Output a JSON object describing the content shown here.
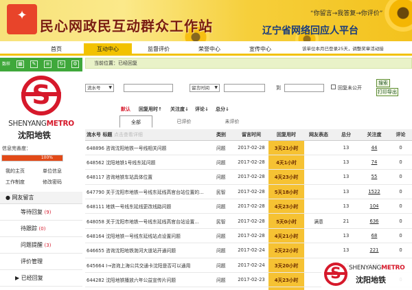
{
  "header": {
    "site_title": "民心网政民互动群众工作站",
    "slogan": "“你留言→我答复→你评价”",
    "platform": "辽宁省网络回应人平台"
  },
  "nav": {
    "tabs": [
      "首页",
      "互动中心",
      "监督评价",
      "荣誉中心",
      "宣传中心"
    ],
    "active": "互动中心",
    "notice": "该单位本月已登录25天，调整奖章活动接"
  },
  "sidebar": {
    "head_label": "数样",
    "head_icons": [
      "grid-icon",
      "edit-icon",
      "list-icon",
      "refresh-icon",
      "settings-icon"
    ],
    "org_en_prefix": "SHENYANG",
    "org_en_suffix": "METRO",
    "org_cn": "沈阳地铁",
    "info_label": "信息完善度：",
    "info_progress": "100%",
    "links": [
      "我的主页",
      "单位信息",
      "工作制度",
      "修改密码"
    ],
    "group_label": "网友留言",
    "menu": [
      {
        "label": "等待回复",
        "count": "(9)"
      },
      {
        "label": "待跟踪",
        "count": "(0)"
      },
      {
        "label": "问题提醒",
        "count": "(3)"
      },
      {
        "label": "评价管理",
        "count": ""
      },
      {
        "label": "已经回复",
        "count": ""
      }
    ]
  },
  "main": {
    "breadcrumb": "当前位置：已经回复",
    "filter": {
      "field_select": "流水号",
      "time_select": "留言时间",
      "to_label": "到",
      "unpublic_label": "回复未公开",
      "search_label": "搜索",
      "print_label": "打印导出"
    },
    "sort": {
      "default": "默认",
      "reply_time": "回复用时↑",
      "attention": "关注度↓",
      "comments": "评论↓",
      "score": "总分↓"
    },
    "subtabs": [
      "全部",
      "已评价",
      "未评价"
    ],
    "columns": [
      "流水号",
      "标题",
      "点击查看详细",
      "类别",
      "留言时间",
      "回复用时",
      "网友表态",
      "总分",
      "关注度",
      "评论"
    ],
    "rows": [
      {
        "id": "648896",
        "title": "咨询沈阳地铁一号线相关问题",
        "cat": "问题",
        "date": "2017-02-28",
        "time": "3天21小时",
        "stance": "",
        "score": "13",
        "attn": "44",
        "cmt": "0"
      },
      {
        "id": "648562",
        "title": "沈阳地铁1号线东延问题",
        "cat": "问题",
        "date": "2017-02-28",
        "time": "4天1小时",
        "stance": "",
        "score": "13",
        "attn": "74",
        "cmt": "0"
      },
      {
        "id": "648117",
        "title": "咨询地铁车站具体位置",
        "cat": "问题",
        "date": "2017-02-28",
        "time": "4天23小时",
        "stance": "",
        "score": "13",
        "attn": "55",
        "cmt": "0"
      },
      {
        "id": "647790",
        "title": "关于沈阳市地铁一号线东延线高官台站位置的...",
        "cat": "民智",
        "date": "2017-02-28",
        "time": "5天18小时",
        "stance": "",
        "score": "13",
        "attn": "1522",
        "cmt": "0"
      },
      {
        "id": "648111",
        "title": "地铁一号线东延线更改线路问题",
        "cat": "问题",
        "date": "2017-02-28",
        "time": "4天23小时",
        "stance": "",
        "score": "13",
        "attn": "104",
        "cmt": "0"
      },
      {
        "id": "648058",
        "title": "关于沈阳市地铁一号线东延线高官台站设置...",
        "cat": "民智",
        "date": "2017-02-28",
        "time": "5天0小时",
        "stance": "满意",
        "score": "21",
        "attn": "636",
        "cmt": "0"
      },
      {
        "id": "648164",
        "title": "沈阳地铁一号线东延线站点设置问题",
        "cat": "问题",
        "date": "2017-02-28",
        "time": "4天21小时",
        "stance": "",
        "score": "13",
        "attn": "68",
        "cmt": "0"
      },
      {
        "id": "646655",
        "title": "咨询沈阳地铁渤河大道站开通问题",
        "cat": "问题",
        "date": "2017-02-24",
        "time": "2天22小时",
        "stance": "",
        "score": "13",
        "attn": "221",
        "cmt": "0"
      },
      {
        "id": "645664",
        "title": "I→咨询上海公共交通卡沈阳是否可以通用",
        "cat": "问题",
        "date": "2017-02-24",
        "time": "3天20小时",
        "stance": "",
        "score": "13",
        "attn": "116",
        "cmt": "0"
      },
      {
        "id": "644282",
        "title": "沈阳地铁播放六年公益宣传片问题",
        "cat": "问题",
        "date": "2017-02-23",
        "time": "4天23小时",
        "stance": "",
        "score": "13",
        "attn": "",
        "cmt": "0"
      },
      {
        "id": "645043",
        "title": "I→咨询地铁东延线农业大学站位置",
        "cat": "问题",
        "date": "2017-02-22",
        "time": "2天0小时",
        "stance": "",
        "score": "",
        "attn": "",
        "cmt": ""
      }
    ]
  },
  "watermark": {
    "en_prefix": "SHENYANG",
    "en_suffix": "METRO",
    "cn": "沈阳地铁"
  },
  "colors": {
    "accent_yellow": "#f2c200",
    "nav_green": "#3fa83b",
    "metro_red": "#d6192b",
    "reply_time_bg": "#f6c233"
  }
}
